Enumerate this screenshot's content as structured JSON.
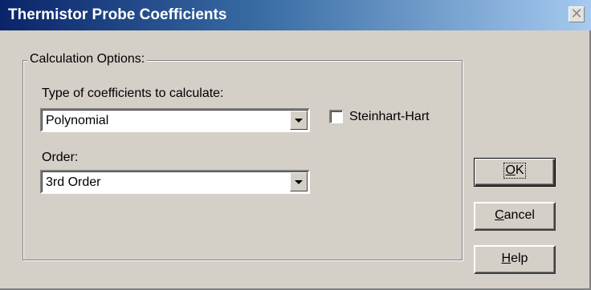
{
  "window": {
    "title": "Thermistor Probe Coefficients",
    "close_glyph": "✕"
  },
  "calculation_options": {
    "group_label": "Calculation Options:",
    "type_label": "Type of coefficients to calculate:",
    "type_value": "Polynomial",
    "steinhart_label": "Steinhart-Hart",
    "steinhart_checked": false,
    "order_label": "Order:",
    "order_value": "3rd Order"
  },
  "buttons": {
    "ok_mnemonic": "O",
    "ok_rest": "K",
    "cancel_mnemonic": "C",
    "cancel_rest": "ancel",
    "help_mnemonic": "H",
    "help_rest": "elp"
  },
  "icons": {
    "dropdown": "chevron-down-icon",
    "close": "close-icon"
  },
  "colors": {
    "face": "#d4d0c8",
    "titlebar_start": "#0a246a",
    "titlebar_end": "#a6caf0"
  }
}
